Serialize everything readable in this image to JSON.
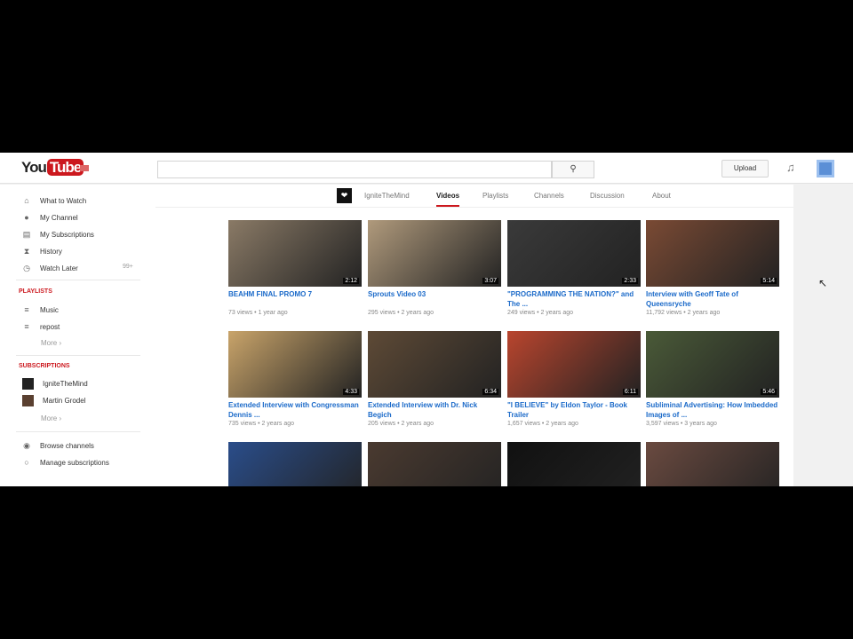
{
  "header": {
    "logo_you": "You",
    "logo_tube": "Tube",
    "search_icon": "search-icon",
    "upload_label": "Upload"
  },
  "sidebar": {
    "items": [
      {
        "label": "What to Watch",
        "icon": "⌂"
      },
      {
        "label": "My Channel",
        "icon": "●"
      },
      {
        "label": "My Subscriptions",
        "icon": "▤"
      },
      {
        "label": "History",
        "icon": "⧗"
      },
      {
        "label": "Watch Later",
        "icon": "◷"
      }
    ],
    "watch_later_count": "99+",
    "playlists_heading": "PLAYLISTS",
    "playlists": [
      {
        "label": "Music"
      },
      {
        "label": "repost"
      }
    ],
    "more": "More ›",
    "subscriptions_heading": "SUBSCRIPTIONS",
    "subscriptions": [
      {
        "label": "IgniteTheMind"
      },
      {
        "label": "Martin Grodel"
      }
    ],
    "bottom": [
      {
        "label": "Browse channels"
      },
      {
        "label": "Manage subscriptions"
      }
    ]
  },
  "channel": {
    "name": "IgniteTheMind",
    "tabs": [
      "Videos",
      "Playlists",
      "Channels",
      "Discussion",
      "About"
    ],
    "active_tab": "Videos"
  },
  "videos": [
    {
      "title": "BEAHM FINAL PROMO 7",
      "meta": "73 views • 1 year ago",
      "duration": "2:12",
      "color": "#8a7a66"
    },
    {
      "title": "Sprouts Video 03",
      "meta": "295 views • 2 years ago",
      "duration": "3:07",
      "color": "#b09a7c"
    },
    {
      "title": "\"PROGRAMMING THE NATION?\" and The ...",
      "meta": "249 views • 2 years ago",
      "duration": "2:33",
      "color": "#3a3a3a"
    },
    {
      "title": "Interview with Geoff Tate of Queensryche",
      "meta": "11,792 views • 2 years ago",
      "duration": "5:14",
      "color": "#7a4a34"
    },
    {
      "title": "Extended Interview with Congressman Dennis ...",
      "meta": "735 views • 2 years ago",
      "duration": "4:33",
      "color": "#c9a46a"
    },
    {
      "title": "Extended Interview with Dr. Nick Begich",
      "meta": "205 views • 2 years ago",
      "duration": "6:34",
      "color": "#5e4a36"
    },
    {
      "title": "\"I BELIEVE\" by Eldon Taylor - Book Trailer",
      "meta": "1,657 views • 2 years ago",
      "duration": "6:11",
      "color": "#b9452e"
    },
    {
      "title": "Subliminal Advertising: How Imbedded Images of ...",
      "meta": "3,597 views • 3 years ago",
      "duration": "5:46",
      "color": "#4a5a38"
    },
    {
      "title": "",
      "meta": "",
      "duration": "",
      "color": "#2a4d8a"
    },
    {
      "title": "",
      "meta": "",
      "duration": "",
      "color": "#4a3a30"
    },
    {
      "title": "",
      "meta": "",
      "duration": "",
      "color": "#111"
    },
    {
      "title": "",
      "meta": "",
      "duration": "",
      "color": "#6a4a40"
    }
  ]
}
